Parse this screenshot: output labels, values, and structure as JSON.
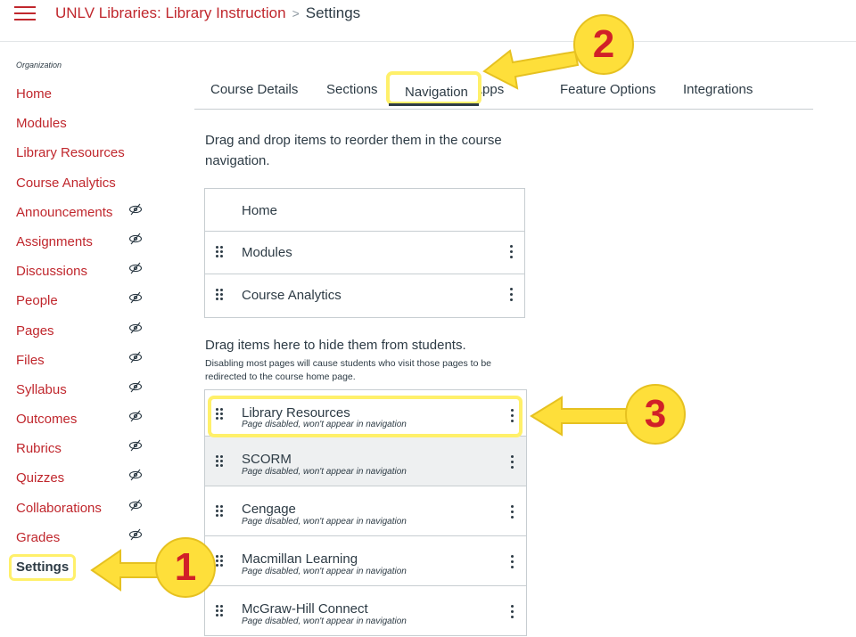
{
  "header": {
    "menu_icon": "hamburger-menu-icon",
    "course_name": "UNLV Libraries: Library Instruction",
    "separator": ">",
    "current_page": "Settings"
  },
  "sidebar": {
    "heading": "Organization",
    "items": [
      {
        "label": "Home",
        "hidden_icon": false
      },
      {
        "label": "Modules",
        "hidden_icon": false
      },
      {
        "label": "Library Resources",
        "hidden_icon": false
      },
      {
        "label": "Course Analytics",
        "hidden_icon": false
      },
      {
        "label": "Announcements",
        "hidden_icon": true
      },
      {
        "label": "Assignments",
        "hidden_icon": true
      },
      {
        "label": "Discussions",
        "hidden_icon": true
      },
      {
        "label": "People",
        "hidden_icon": true
      },
      {
        "label": "Pages",
        "hidden_icon": true
      },
      {
        "label": "Files",
        "hidden_icon": true
      },
      {
        "label": "Syllabus",
        "hidden_icon": true
      },
      {
        "label": "Outcomes",
        "hidden_icon": true
      },
      {
        "label": "Rubrics",
        "hidden_icon": true
      },
      {
        "label": "Quizzes",
        "hidden_icon": true
      },
      {
        "label": "Collaborations",
        "hidden_icon": true
      },
      {
        "label": "Grades",
        "hidden_icon": true
      },
      {
        "label": "Settings",
        "hidden_icon": false,
        "active": true
      }
    ]
  },
  "tabs": [
    {
      "label": "Course Details"
    },
    {
      "label": "Sections"
    },
    {
      "label": "Navigation",
      "active": true
    },
    {
      "label": "Apps"
    },
    {
      "label": "Feature Options"
    },
    {
      "label": "Integrations"
    }
  ],
  "navigation": {
    "instructions": "Drag and drop items to reorder them in the course navigation.",
    "enabled_items": [
      {
        "label": "Home",
        "draggable": false
      },
      {
        "label": "Modules",
        "draggable": true
      },
      {
        "label": "Course Analytics",
        "draggable": true
      }
    ],
    "hidden_title": "Drag items here to hide them from students.",
    "hidden_note": "Disabling most pages will cause students who visit those pages to be redirected to the course home page.",
    "disabled_items": [
      {
        "label": "Library Resources",
        "sub": "Page disabled, won't appear in navigation"
      },
      {
        "label": "SCORM",
        "sub": "Page disabled, won't appear in navigation"
      },
      {
        "label": "Cengage",
        "sub": "Page disabled, won't appear in navigation"
      },
      {
        "label": "Macmillan Learning",
        "sub": "Page disabled, won't appear in navigation"
      },
      {
        "label": "McGraw-Hill Connect",
        "sub": "Page disabled, won't appear in navigation"
      }
    ]
  },
  "callouts": [
    {
      "number": "1"
    },
    {
      "number": "2"
    },
    {
      "number": "3"
    }
  ],
  "colors": {
    "link_red": "#c0272d",
    "text": "#2d3b45",
    "highlight_yellow": "#fff06a",
    "callout_fill": "#fedf3a",
    "callout_number": "#d12028"
  }
}
